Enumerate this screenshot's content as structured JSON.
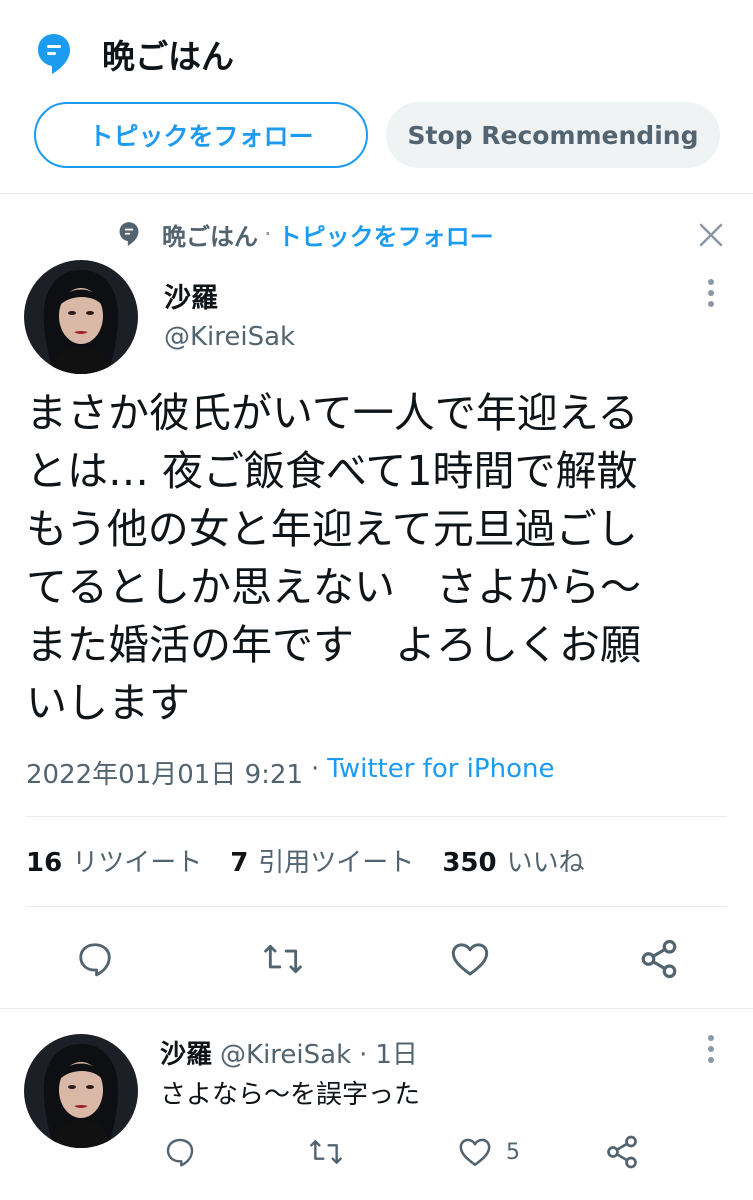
{
  "topic": {
    "title": "晩ごはん",
    "follow_label": "トピックをフォロー",
    "stop_label": "Stop Recommending"
  },
  "context": {
    "topic": "晩ごはん",
    "separator": "·",
    "follow": "トピックをフォロー"
  },
  "tweet": {
    "display_name": "沙羅",
    "handle": "@KireiSak",
    "text": "まさか彼氏がいて一人で年迎える\nとは… 夜ご飯食べて1時間で解散\nもう他の女と年迎えて元旦過ごし\nてるとしか思えない　さよから〜\nまた婚活の年です　よろしくお願\nいします",
    "date": "2022年01月01日 9:21",
    "separator": "·",
    "source": "Twitter for iPhone",
    "retweets": "16",
    "retweets_label": "リツイート",
    "quotes": "7",
    "quotes_label": "引用ツイート",
    "likes": "350",
    "likes_label": "いいね"
  },
  "reply": {
    "display_name": "沙羅",
    "handle": "@KireiSak",
    "separator": "·",
    "time": "1日",
    "text": "さよなら〜を誤字った",
    "like_count": "5"
  },
  "colors": {
    "accent": "#1d9bf0",
    "secondary_text": "#536471",
    "divider": "#e6ecf0"
  },
  "icons": [
    "topic-icon",
    "close-icon",
    "more-icon",
    "reply-icon",
    "retweet-icon",
    "like-icon",
    "share-icon"
  ]
}
